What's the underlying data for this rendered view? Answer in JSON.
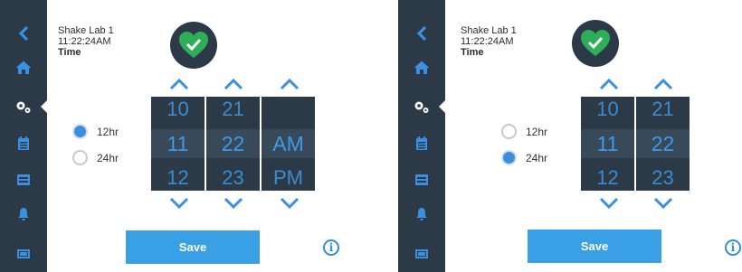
{
  "colors": {
    "sidebar": "#2c3a47",
    "accent": "#3a8fe0",
    "picker_bg": "#2c3a47",
    "picker_digit": "#3e9ae8",
    "save_button": "#3aa0e6",
    "heart": "#2fae5a"
  },
  "left": {
    "header": {
      "device": "Shake Lab 1",
      "clock": "11:22:24AM",
      "section": "Time"
    },
    "format_options": [
      {
        "label": "12hr",
        "selected": true
      },
      {
        "label": "24hr",
        "selected": false
      }
    ],
    "picker": {
      "hour": {
        "prev": "10",
        "current": "11",
        "next": "12"
      },
      "minute": {
        "prev": "21",
        "current": "22",
        "next": "23"
      },
      "period": {
        "prev": "",
        "current": "AM",
        "next": "PM"
      }
    },
    "save_label": "Save",
    "info_label": "i"
  },
  "right": {
    "header": {
      "device": "Shake Lab 1",
      "clock": "11:22:24AM",
      "section": "Time"
    },
    "format_options": [
      {
        "label": "12hr",
        "selected": false
      },
      {
        "label": "24hr",
        "selected": true
      }
    ],
    "picker": {
      "hour": {
        "prev": "10",
        "current": "11",
        "next": "12"
      },
      "minute": {
        "prev": "21",
        "current": "22",
        "next": "23"
      }
    },
    "save_label": "Save",
    "info_label": "i"
  },
  "sidebar_icons": [
    "back-icon",
    "home-icon",
    "settings-icon",
    "calendar-icon",
    "schedule-icon",
    "bell-icon",
    "display-icon"
  ]
}
